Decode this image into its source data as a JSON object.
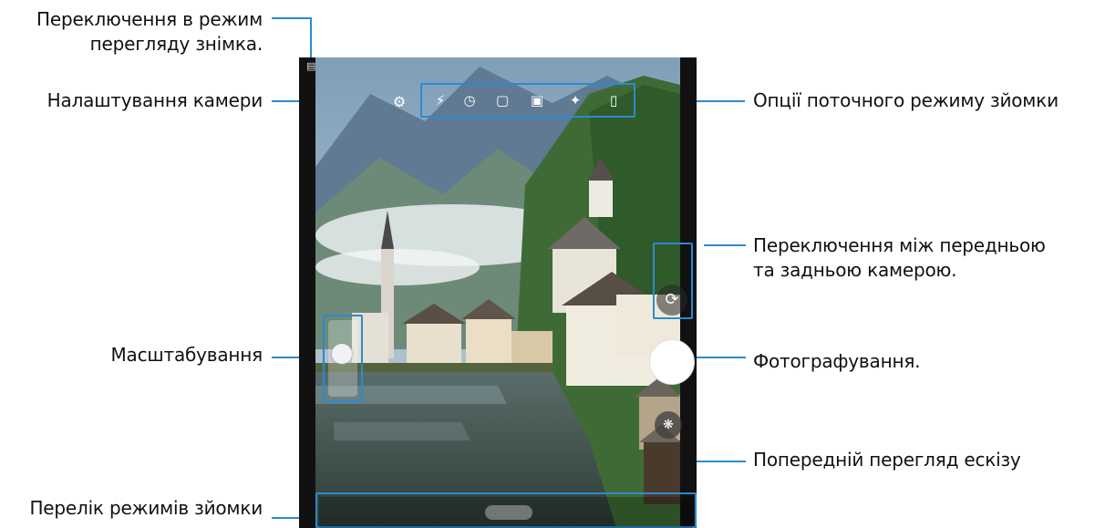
{
  "annotations": {
    "view_mode_switch": "Переключення в режим перегляду знімка.",
    "camera_settings": "Налаштування камери",
    "current_mode_options": "Опції поточного режиму зйомки",
    "switch_camera": "Переключення між передньою та задньою камерою.",
    "zoom": "Масштабування",
    "take_photo": "Фотографування.",
    "preview_thumbnail": "Попередній перегляд ескізу",
    "shooting_modes_list": "Перелік режимів зйомки"
  },
  "icons": {
    "view_mode": "view-mode-icon",
    "settings": "gear-icon",
    "options": [
      "flash-off-icon",
      "timer-icon",
      "aspect-ratio-icon",
      "motion-photo-icon",
      "filter-icon",
      "more-icon"
    ],
    "switch_camera": "switch-camera-icon",
    "thumbnail": "thumbnail-icon"
  },
  "colors": {
    "callout_line": "#2a8bd0",
    "shutter": "#ffffff"
  }
}
